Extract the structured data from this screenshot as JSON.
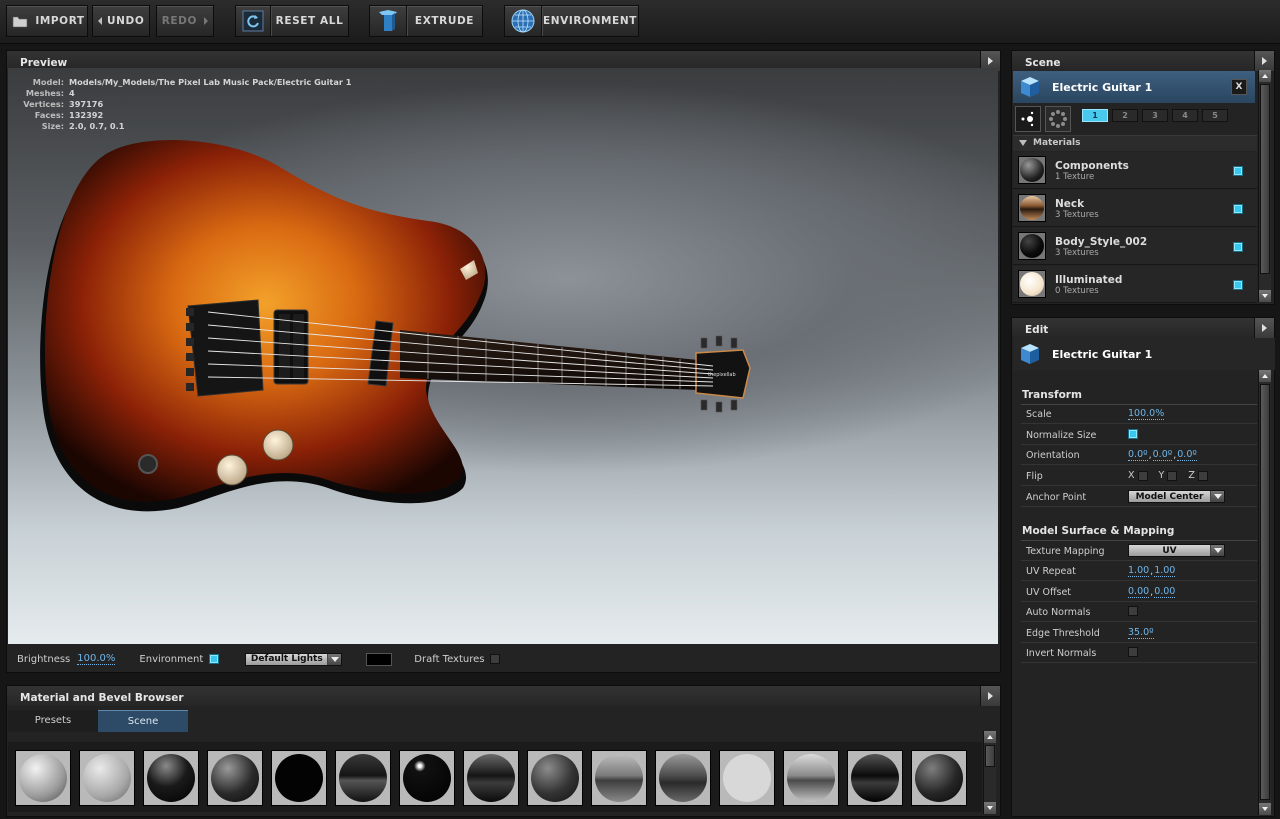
{
  "toolbar": {
    "import": "IMPORT",
    "undo": "UNDO",
    "redo": "REDO",
    "reset_all": "RESET ALL",
    "extrude": "EXTRUDE",
    "environment": "ENVIRONMENT"
  },
  "preview": {
    "title": "Preview",
    "stats": [
      {
        "label": "Model:",
        "value": "Models/My_Models/The Pixel Lab Music Pack/Electric Guitar 1"
      },
      {
        "label": "Meshes:",
        "value": "4"
      },
      {
        "label": "Vertices:",
        "value": "397176"
      },
      {
        "label": "Faces:",
        "value": "132392"
      },
      {
        "label": "Size:",
        "value": "2.0, 0.7, 0.1"
      }
    ],
    "headstock_logo": "thepixellab",
    "bottom": {
      "brightness_label": "Brightness",
      "brightness_value": "100.0%",
      "environment_label": "Environment",
      "environment_checked": true,
      "lights_value": "Default Lights",
      "draft_label": "Draft Textures",
      "draft_checked": false
    }
  },
  "browser": {
    "title": "Material and Bevel Browser",
    "tabs": [
      "Presets",
      "Scene"
    ],
    "active_tab": "Scene"
  },
  "scene": {
    "title": "Scene",
    "object_name": "Electric Guitar 1",
    "close_label": "X",
    "numbers": [
      "1",
      "2",
      "3",
      "4",
      "5"
    ],
    "active_number": "1",
    "materials_header": "Materials",
    "materials": [
      {
        "name": "Components",
        "sub": "1 Texture",
        "checked": true
      },
      {
        "name": "Neck",
        "sub": "3 Textures",
        "checked": true
      },
      {
        "name": "Body_Style_002",
        "sub": "3 Textures",
        "checked": true
      },
      {
        "name": "Illuminated",
        "sub": "0 Textures",
        "checked": true
      }
    ]
  },
  "edit": {
    "title": "Edit",
    "object_name": "Electric Guitar 1",
    "transform_title": "Transform",
    "scale_label": "Scale",
    "scale_value": "100.0%",
    "normalize_label": "Normalize Size",
    "normalize_checked": true,
    "orientation_label": "Orientation",
    "orientation_x": "0.0º",
    "orientation_y": "0.0º",
    "orientation_z": "0.0º",
    "flip_label": "Flip",
    "flip_x": "X",
    "flip_y": "Y",
    "flip_z": "Z",
    "anchor_label": "Anchor Point",
    "anchor_value": "Model Center",
    "surface_title": "Model Surface & Mapping",
    "texture_mapping_label": "Texture Mapping",
    "texture_mapping_value": "UV",
    "uv_repeat_label": "UV Repeat",
    "uv_repeat_u": "1.00",
    "uv_repeat_v": "1.00",
    "uv_offset_label": "UV Offset",
    "uv_offset_u": "0.00",
    "uv_offset_v": "0.00",
    "auto_normals_label": "Auto Normals",
    "edge_threshold_label": "Edge Threshold",
    "edge_threshold_value": "35.0º",
    "invert_normals_label": "Invert Normals"
  },
  "colors": {
    "accent_blue": "#49c9ee",
    "link_blue": "#6fb6ea",
    "selected_header": "#2a4660"
  }
}
